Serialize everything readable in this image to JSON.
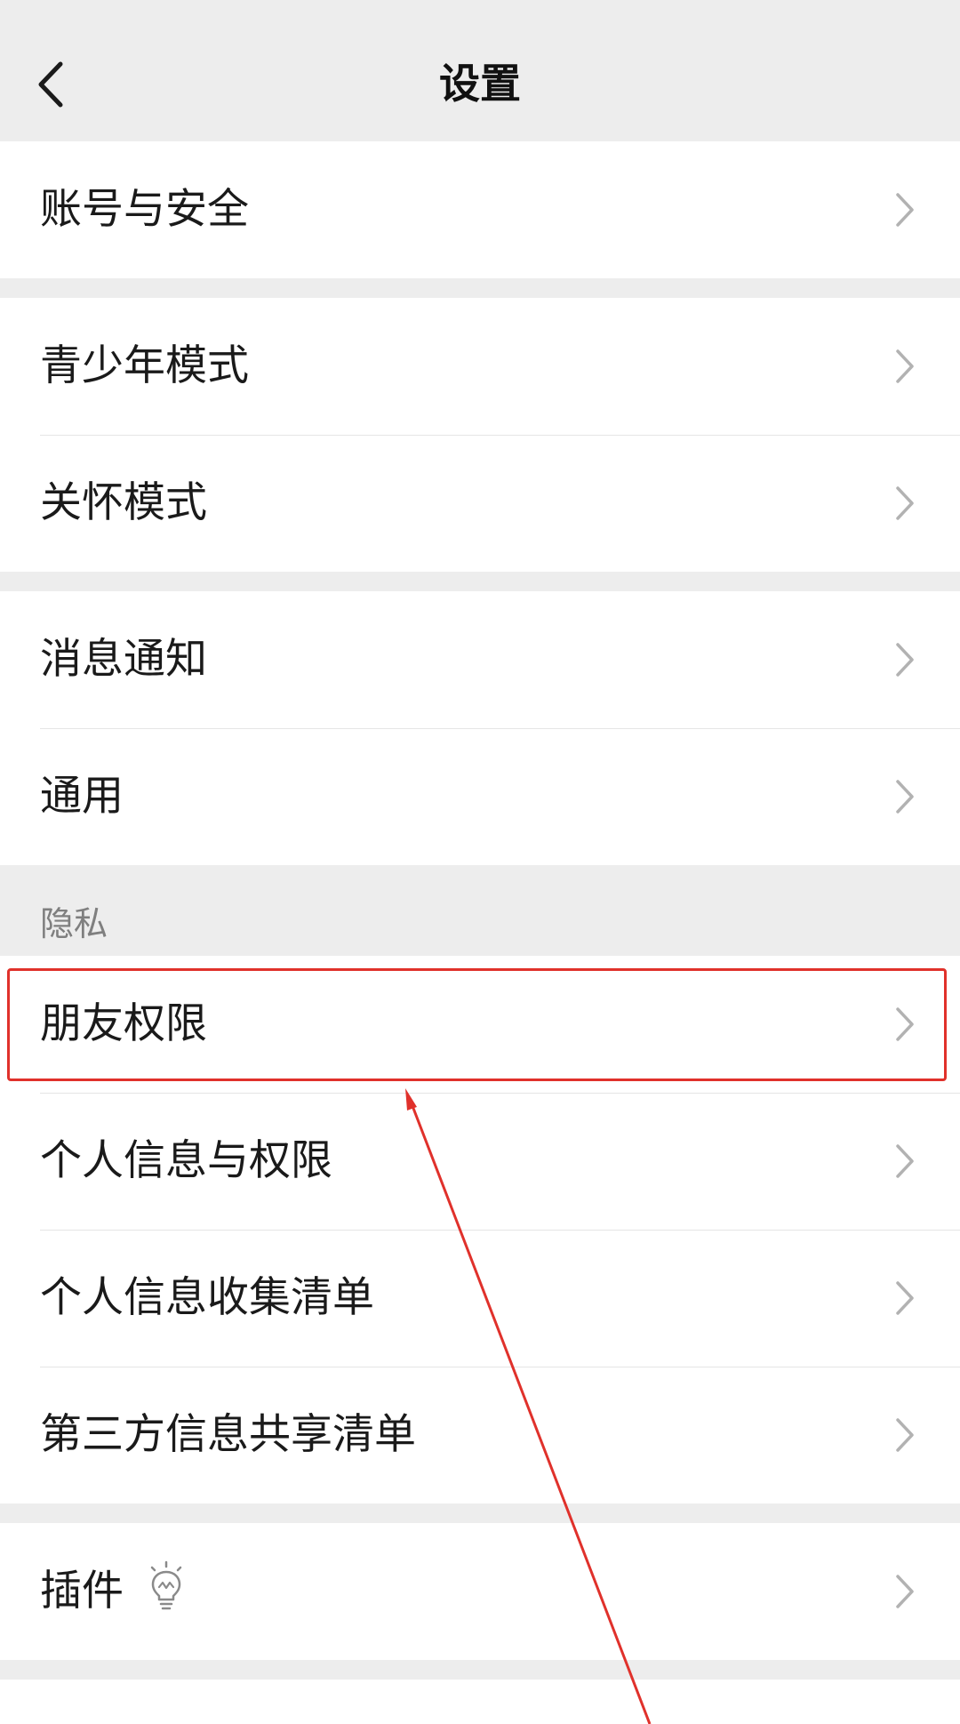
{
  "nav": {
    "title": "设置",
    "back_icon": "chevron-left-icon"
  },
  "groups": [
    {
      "items": [
        "账号与安全"
      ]
    },
    {
      "items": [
        "青少年模式",
        "关怀模式"
      ]
    },
    {
      "items": [
        "消息通知",
        "通用"
      ]
    },
    {
      "section_title": "隐私",
      "items": [
        "朋友权限",
        "个人信息与权限",
        "个人信息收集清单",
        "第三方信息共享清单"
      ]
    },
    {
      "items": [
        "插件"
      ],
      "plugin_icon": "lightbulb-icon"
    }
  ],
  "annotation": {
    "highlighted_item": "朋友权限",
    "color": "#e0312b"
  },
  "colors": {
    "background": "#ededed",
    "cell": "#ffffff",
    "divider": "#e5e5e5",
    "chevron": "#b2b2b2",
    "section_title": "#7f7f7f"
  }
}
